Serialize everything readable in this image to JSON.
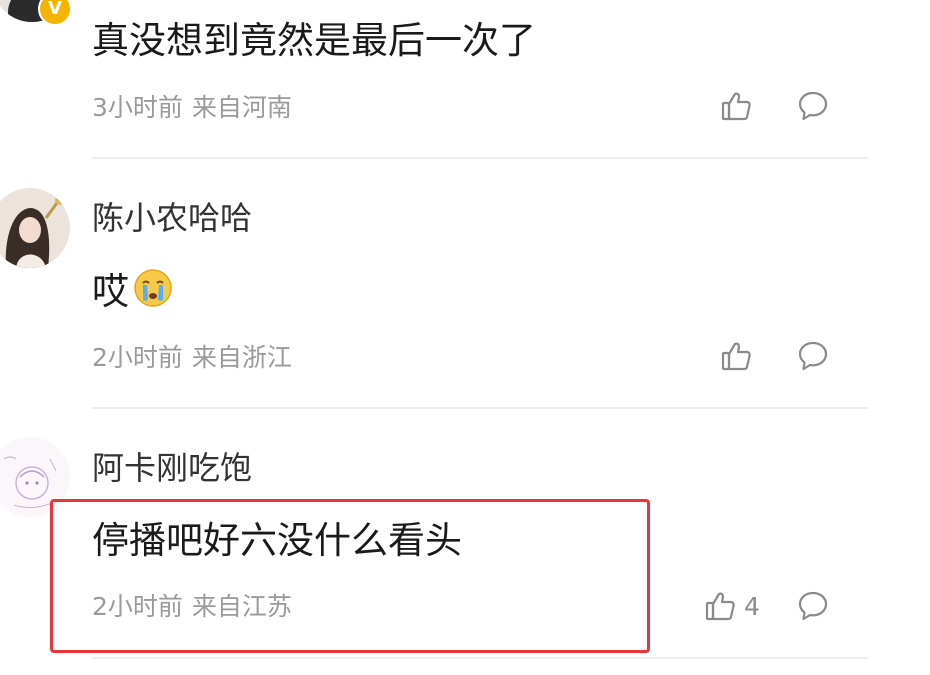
{
  "comments": [
    {
      "username": "",
      "text": "真没想到竟然是最后一次了",
      "time": "3小时前",
      "location": "来自河南",
      "likes": "",
      "badge": "V"
    },
    {
      "username": "陈小农哈哈",
      "text": "哎",
      "time": "2小时前",
      "location": "来自浙江",
      "likes": "",
      "emoji": "crying-face"
    },
    {
      "username": "阿卡刚吃饱",
      "text": "停播吧好六没什么看头",
      "time": "2小时前",
      "location": "来自江苏",
      "likes": "4"
    }
  ],
  "colors": {
    "highlight": "#e8343a",
    "text": "#1a1a1a",
    "meta": "#9a9a9a",
    "icon": "#8a8a8a",
    "badge": "#f5b400"
  },
  "icons": {
    "like": "thumbs-up-icon",
    "reply": "speech-bubble-icon"
  }
}
